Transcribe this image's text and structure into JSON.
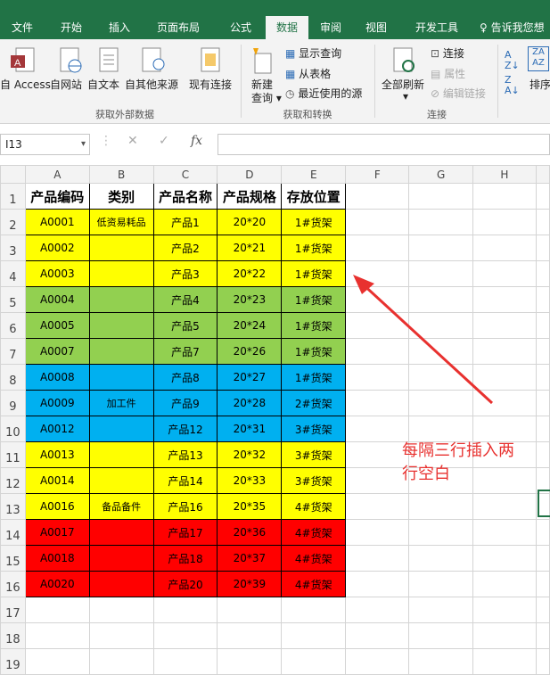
{
  "tabs": [
    "文件",
    "开始",
    "插入",
    "页面布局",
    "公式",
    "数据",
    "审阅",
    "视图",
    "开发工具",
    "告诉我您想"
  ],
  "ribbon": {
    "get_external": {
      "access": "自 Access",
      "web": "自网站",
      "text": "自文本",
      "other": "自其他来源",
      "existing": "现有连接",
      "group_label": "获取外部数据"
    },
    "transform": {
      "new_query_1": "新建",
      "new_query_2": "查询",
      "show_queries": "显示查询",
      "from_table": "从表格",
      "recent": "最近使用的源",
      "group_label": "获取和转换"
    },
    "connections": {
      "refresh_all": "全部刷新",
      "connections": "连接",
      "properties": "属性",
      "edit_links": "编辑链接",
      "group_label": "连接"
    },
    "sort": {
      "label": "排序"
    }
  },
  "formula_bar": {
    "name_box": "I13",
    "fx": "fx",
    "value": ""
  },
  "columns": [
    "A",
    "B",
    "C",
    "D",
    "E",
    "F",
    "G",
    "H"
  ],
  "headers": [
    "产品编码",
    "类别",
    "产品名称",
    "产品规格",
    "存放位置"
  ],
  "rows": [
    {
      "n": "2",
      "a": "A0001",
      "b": "低资易耗品",
      "c": "产品1",
      "d": "20*20",
      "e": "1#货架",
      "color": "y"
    },
    {
      "n": "3",
      "a": "A0002",
      "b": "",
      "c": "产品2",
      "d": "20*21",
      "e": "1#货架",
      "color": "y"
    },
    {
      "n": "4",
      "a": "A0003",
      "b": "",
      "c": "产品3",
      "d": "20*22",
      "e": "1#货架",
      "color": "y"
    },
    {
      "n": "5",
      "a": "A0004",
      "b": "",
      "c": "产品4",
      "d": "20*23",
      "e": "1#货架",
      "color": "g"
    },
    {
      "n": "6",
      "a": "A0005",
      "b": "",
      "c": "产品5",
      "d": "20*24",
      "e": "1#货架",
      "color": "g"
    },
    {
      "n": "7",
      "a": "A0007",
      "b": "",
      "c": "产品7",
      "d": "20*26",
      "e": "1#货架",
      "color": "g"
    },
    {
      "n": "8",
      "a": "A0008",
      "b": "",
      "c": "产品8",
      "d": "20*27",
      "e": "1#货架",
      "color": "bl"
    },
    {
      "n": "9",
      "a": "A0009",
      "b": "加工件",
      "c": "产品9",
      "d": "20*28",
      "e": "2#货架",
      "color": "bl"
    },
    {
      "n": "10",
      "a": "A0012",
      "b": "",
      "c": "产品12",
      "d": "20*31",
      "e": "3#货架",
      "color": "bl"
    },
    {
      "n": "11",
      "a": "A0013",
      "b": "",
      "c": "产品13",
      "d": "20*32",
      "e": "3#货架",
      "color": "y"
    },
    {
      "n": "12",
      "a": "A0014",
      "b": "",
      "c": "产品14",
      "d": "20*33",
      "e": "3#货架",
      "color": "y"
    },
    {
      "n": "13",
      "a": "A0016",
      "b": "备品备件",
      "c": "产品16",
      "d": "20*35",
      "e": "4#货架",
      "color": "y"
    },
    {
      "n": "14",
      "a": "A0017",
      "b": "",
      "c": "产品17",
      "d": "20*36",
      "e": "4#货架",
      "color": "r"
    },
    {
      "n": "15",
      "a": "A0018",
      "b": "",
      "c": "产品18",
      "d": "20*37",
      "e": "4#货架",
      "color": "r"
    },
    {
      "n": "16",
      "a": "A0020",
      "b": "",
      "c": "产品20",
      "d": "20*39",
      "e": "4#货架",
      "color": "r"
    }
  ],
  "empty_rows": [
    "17",
    "18",
    "19"
  ],
  "header_row_num": "1",
  "annotation": {
    "line1": "每隔三行插入两",
    "line2": "行空白"
  },
  "colors": {
    "excel_green": "#217346",
    "yellow": "#ffff00",
    "green": "#92d050",
    "blue": "#00b0f0",
    "red": "#ff0000",
    "annotation": "#e8312f"
  }
}
